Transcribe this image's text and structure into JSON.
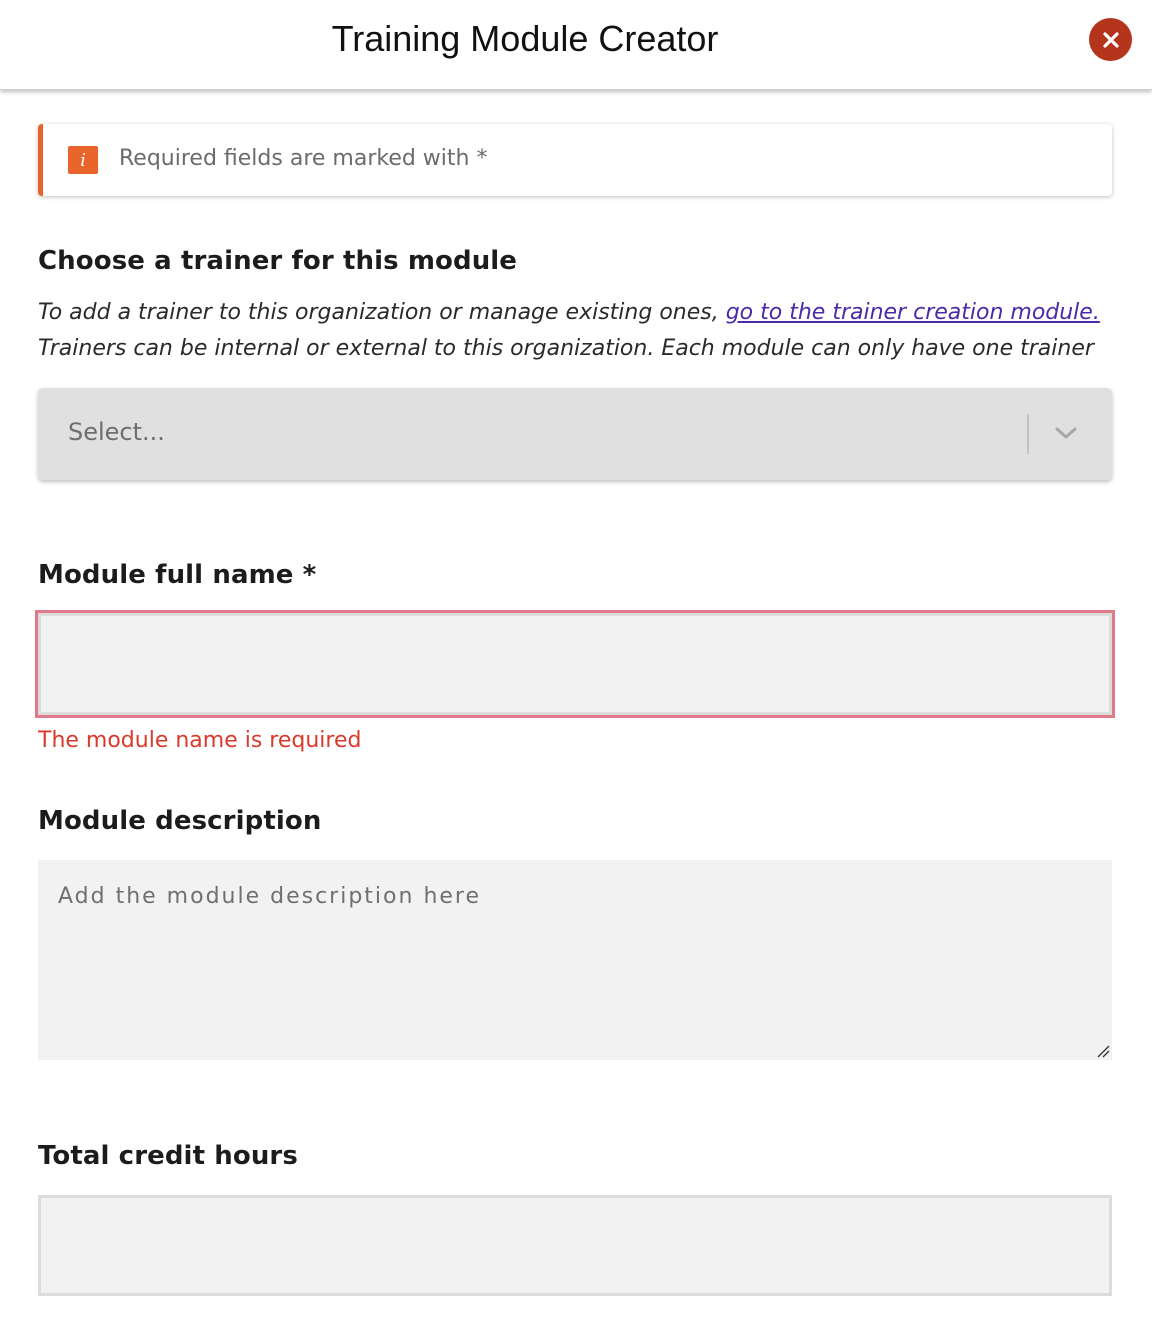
{
  "header": {
    "title": "Training Module Creator",
    "close_label": "X"
  },
  "notice": {
    "icon_glyph": "i",
    "icon": "info-icon",
    "text": "Required fields are marked with *",
    "accent_color": "#e8642a"
  },
  "trainer_section": {
    "heading": "Choose a trainer for this module",
    "help_prefix": "To add a trainer to this organization or manage existing ones,",
    "help_link": "go to the trainer creation module.",
    "help_line2": "Trainers can be internal or external to this organization. Each module can only have one trainer",
    "select": {
      "placeholder": "Select...",
      "value": ""
    }
  },
  "module_name": {
    "label": "Module full name *",
    "value": "",
    "error": "The module name is required",
    "error_color": "#d93a2b"
  },
  "module_description": {
    "label": "Module description",
    "placeholder": "Add the module description here",
    "value": ""
  },
  "credit_hours": {
    "label": "Total credit hours",
    "value": ""
  }
}
